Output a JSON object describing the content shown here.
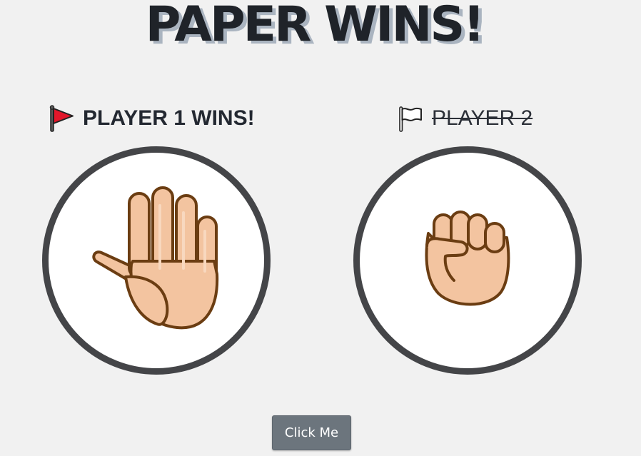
{
  "header": {
    "title": "PAPER WINS!"
  },
  "players": [
    {
      "label": "PLAYER 1 WINS!",
      "flag_icon": "red-flag-icon",
      "flag_color": "#e2162a",
      "hand_icon": "raised-hand-icon",
      "is_winner": true
    },
    {
      "label": "PLAYER 2",
      "flag_icon": "white-flag-icon",
      "flag_color": "#ffffff",
      "hand_icon": "raised-fist-icon",
      "is_winner": false
    }
  ],
  "button": {
    "label": "Click Me"
  },
  "colors": {
    "background": "#f1f1f1",
    "title_text": "#1f2329",
    "title_shadow": "#aab4c0",
    "circle_border": "#444548",
    "skin": "#f3c4a0",
    "skin_outline": "#6b3d12",
    "button_bg": "#6c757d"
  }
}
